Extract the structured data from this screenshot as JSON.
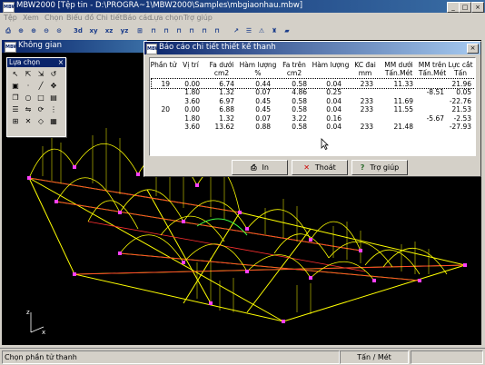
{
  "app": {
    "title": "MBW2000 [Tệp tin - D:\\PROGRA~1\\MBW2000\\Samples\\mbgiaonhau.mbw]",
    "icon_label": "MBW"
  },
  "menu": [
    "Tệp",
    "Xem",
    "Chọn",
    "Biểu đồ",
    "Chi tiết",
    "Báo cáo",
    "Lựa chọn",
    "Trợ giúp"
  ],
  "toolbar": {
    "icons": [
      "print-icon",
      "zoom-window-icon",
      "zoom-in-icon",
      "zoom-out-icon",
      "zoom-all-icon",
      "view-3d-icon",
      "view-xy-icon",
      "view-xz-icon",
      "view-yz-icon",
      "grid-icon",
      "frame-a-icon",
      "frame-b-icon",
      "frame-c-icon",
      "frame-d-icon",
      "frame-e-icon",
      "frame-f-icon",
      "arrow-tool-icon",
      "list-tool-icon",
      "warning-icon",
      "load-icon",
      "folder-icon"
    ],
    "labels": {
      "3d": "3d",
      "xy": "xy",
      "xz": "xz",
      "yz": "yz"
    }
  },
  "workspace": {
    "title": "Không gian",
    "axes": {
      "z": "z",
      "x": "x"
    }
  },
  "palette": {
    "title": "Lựa chọn",
    "tools": [
      "select-arrow-icon",
      "select-node-icon",
      "select-bar-icon",
      "undo-select-icon",
      "frame-icon",
      "node-icon",
      "bar-icon",
      "move-icon",
      "copy-icon",
      "circle-icon",
      "rect-icon",
      "group-icon",
      "list-icon",
      "mirror-icon",
      "rotate-icon",
      "array-icon",
      "grid-select-icon",
      "cross-icon",
      "plane-icon",
      "region-icon"
    ]
  },
  "dialog": {
    "title": "Báo cáo chi tiết thiết kế thanh",
    "headers": [
      [
        "Phần tử"
      ],
      [
        "Vị trí"
      ],
      [
        "Fa dưới",
        "cm2"
      ],
      [
        "Hàm lượng",
        "%"
      ],
      [
        "Fa trên",
        "cm2"
      ],
      [
        "Hàm lượng"
      ],
      [
        "KC đai",
        "mm"
      ],
      [
        "MM dưới",
        "Tấn.Mét"
      ],
      [
        "MM trên",
        "Tấn.Mét"
      ],
      [
        "Lực cắt",
        "Tấn"
      ]
    ],
    "rows": [
      [
        "19",
        "0.00",
        "6.74",
        "0.44",
        "0.58",
        "0.04",
        "233",
        "11.33",
        "",
        "21.96"
      ],
      [
        "",
        "1.80",
        "1.32",
        "0.07",
        "4.86",
        "0.25",
        "",
        "",
        "-8.51",
        "0.05"
      ],
      [
        "",
        "3.60",
        "6.97",
        "0.45",
        "0.58",
        "0.04",
        "233",
        "11.69",
        "",
        "-22.76"
      ],
      [
        "20",
        "0.00",
        "6.88",
        "0.45",
        "0.58",
        "0.04",
        "233",
        "11.55",
        "",
        "21.53"
      ],
      [
        "",
        "1.80",
        "1.32",
        "0.07",
        "3.22",
        "0.16",
        "",
        "",
        "-5.67",
        "-2.53"
      ],
      [
        "",
        "3.60",
        "13.62",
        "0.88",
        "0.58",
        "0.04",
        "233",
        "21.48",
        "",
        "-27.93"
      ]
    ],
    "buttons": {
      "print": "In",
      "exit": "Thoát",
      "help": "Trợ giúp"
    },
    "button_icons": {
      "print": "printer-icon",
      "exit": "x-icon",
      "help": "question-icon"
    }
  },
  "status": {
    "left": "Chọn phần tử thanh",
    "unit": "Tấn / Mét"
  },
  "colors": {
    "frame_yellow": "#ffff00",
    "frame_red": "#ff3030",
    "node_magenta": "#ff40ff",
    "axis_white": "#ffffff",
    "title_blue": "#0a246a"
  }
}
